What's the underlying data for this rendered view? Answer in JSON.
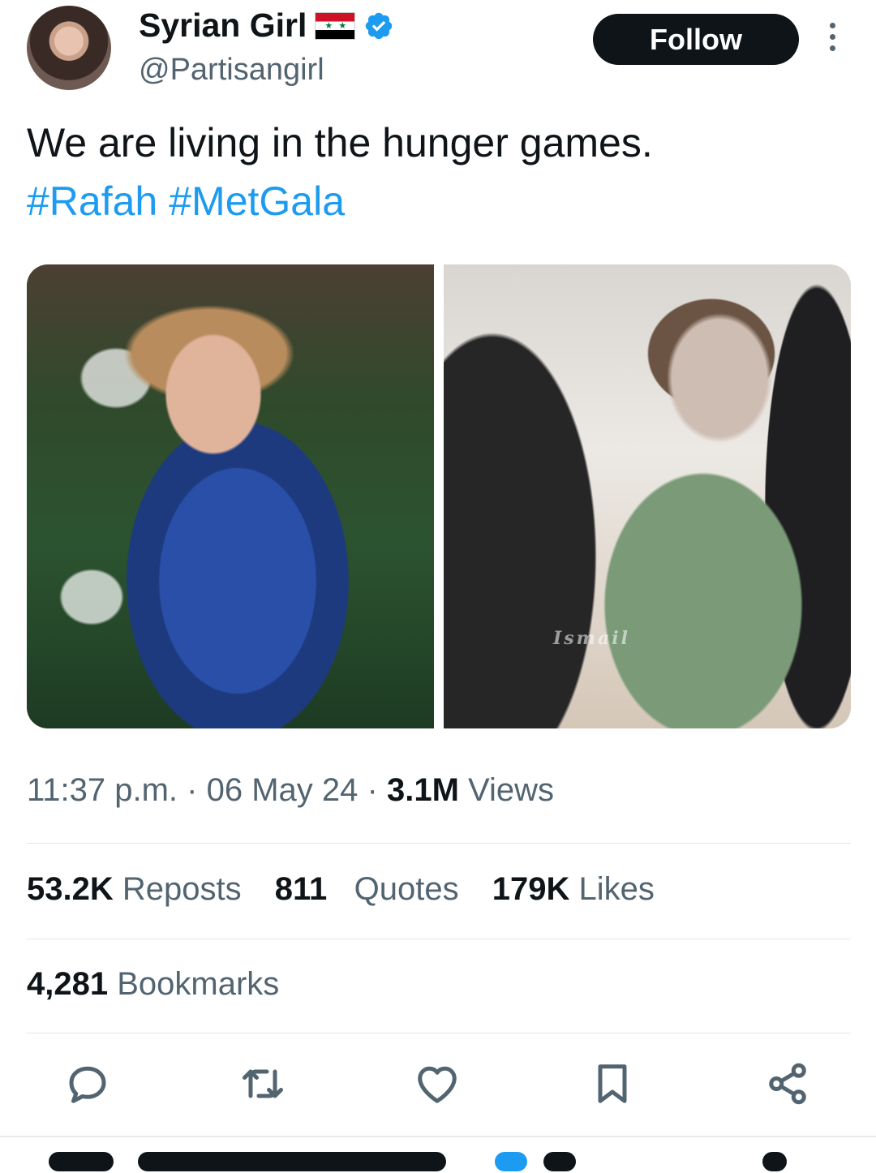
{
  "author": {
    "display_name": "Syrian Girl",
    "flag_icon": "syria-flag-icon",
    "verified_icon": "verified-badge-icon",
    "verified_color": "#1d9bf0",
    "handle": "@Partisangirl"
  },
  "follow_button": {
    "label": "Follow"
  },
  "more_icon": "more-options-icon",
  "tweet": {
    "text": "We are living in the hunger games.",
    "hashtags": [
      "#Rafah",
      "#MetGala"
    ],
    "link_color": "#1d9bf0",
    "media": [
      {
        "name": "photo-met-gala-gown"
      },
      {
        "name": "photo-crying-child",
        "watermark": "Ismail"
      }
    ]
  },
  "meta": {
    "time": "11:37 p.m.",
    "separator": "·",
    "date": "06 May 24",
    "views_count": "3.1M",
    "views_label": "Views"
  },
  "stats": {
    "reposts_count": "53.2K",
    "reposts_label": "Reposts",
    "quotes_count": "811",
    "quotes_label": "Quotes",
    "likes_count": "179K",
    "likes_label": "Likes",
    "bookmarks_count": "4,281",
    "bookmarks_label": "Bookmarks"
  },
  "actions": [
    "reply-icon",
    "repost-icon",
    "like-icon",
    "bookmark-icon",
    "share-icon"
  ]
}
